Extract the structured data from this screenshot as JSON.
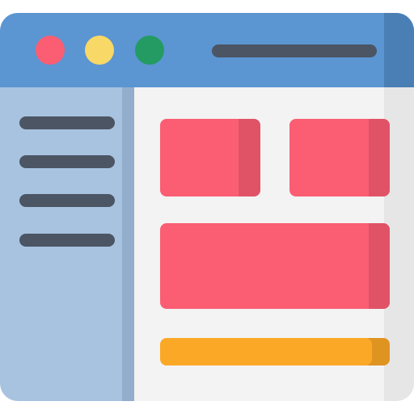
{
  "window": {
    "icon_name": "browser-window-layout-icon",
    "colors": {
      "titlebar": "#5B95D2",
      "titlebar_shade": "#4A7FB6",
      "sidebar": "#A8C3E0",
      "sidebar_shade": "#93AECC",
      "content": "#F3F3F3",
      "content_shade": "#E6E6E6",
      "line": "#4B5563",
      "block": "#FB5E73",
      "block_shade": "#E05367",
      "bar": "#FBA827",
      "bar_shade": "#DF9422",
      "dot_close": "#FB5E73",
      "dot_minimize": "#F8D866",
      "dot_maximize": "#249B62"
    }
  }
}
